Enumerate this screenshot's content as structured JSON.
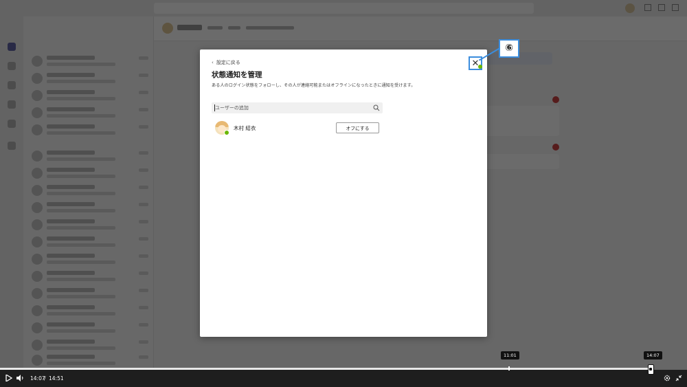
{
  "dialog": {
    "back_label": "設定に戻る",
    "title": "状態通知を管理",
    "description": "ある人のログイン状態をフォローし、その人が連絡可能またはオフラインになったときに通知を受けます。",
    "search_placeholder": "ユーザーの追加",
    "search_value": "",
    "user": {
      "name": "木村 結衣",
      "presence": "available"
    },
    "off_button_label": "オフにする",
    "close_icon": "close-icon"
  },
  "callout": {
    "label": "⑥"
  },
  "player": {
    "current_time": "14:07",
    "separator": "/",
    "total_time": "14:51",
    "hover_tooltip": "11:01",
    "current_tooltip": "14:07",
    "progress_fraction": 0.948
  },
  "colors": {
    "callout_border": "#3b8ddd",
    "presence_green": "#6bb700",
    "overlay": "rgba(0,0,0,0.58)"
  }
}
